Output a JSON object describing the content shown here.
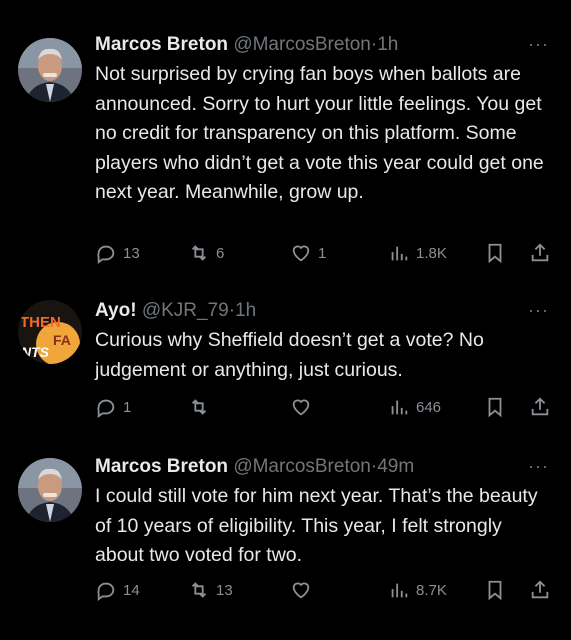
{
  "tweets": [
    {
      "author": "Marcos Breton",
      "handle": "@MarcosBreton",
      "time": "1h",
      "text": "Not surprised by crying fan boys when ballots are announced. Sorry to hurt your little feelings. You get no credit for transparency on this platform. Some players who didn’t get a vote this year could get one next year. Meanwhile, grow up.",
      "replies": "13",
      "retweets": "6",
      "likes": "1",
      "views": "1.8K"
    },
    {
      "author": "Ayo!",
      "handle": "@KJR_79",
      "time": "1h",
      "avatar_text": [
        "THEN",
        "FA",
        "NTS"
      ],
      "text": "Curious why Sheffield doesn’t get a vote? No judgement or anything, just curious.",
      "replies": "1",
      "retweets": "",
      "likes": "",
      "views": "646"
    },
    {
      "author": "Marcos Breton",
      "handle": "@MarcosBreton",
      "time": "49m",
      "text": "I could still vote for him next year. That’s the beauty of 10 years of eligibility. This year, I felt strongly about two voted for two.",
      "replies": "14",
      "retweets": "13",
      "likes": "",
      "views": "8.7K"
    }
  ],
  "more_label": "···",
  "dot": "·",
  "icons": {
    "reply": "reply-icon",
    "retweet": "retweet-icon",
    "like": "heart-icon",
    "views": "views-icon",
    "bookmark": "bookmark-icon",
    "share": "share-icon"
  },
  "colors": {
    "background": "#000000",
    "text": "#e7e9ea",
    "muted": "#71767b"
  }
}
